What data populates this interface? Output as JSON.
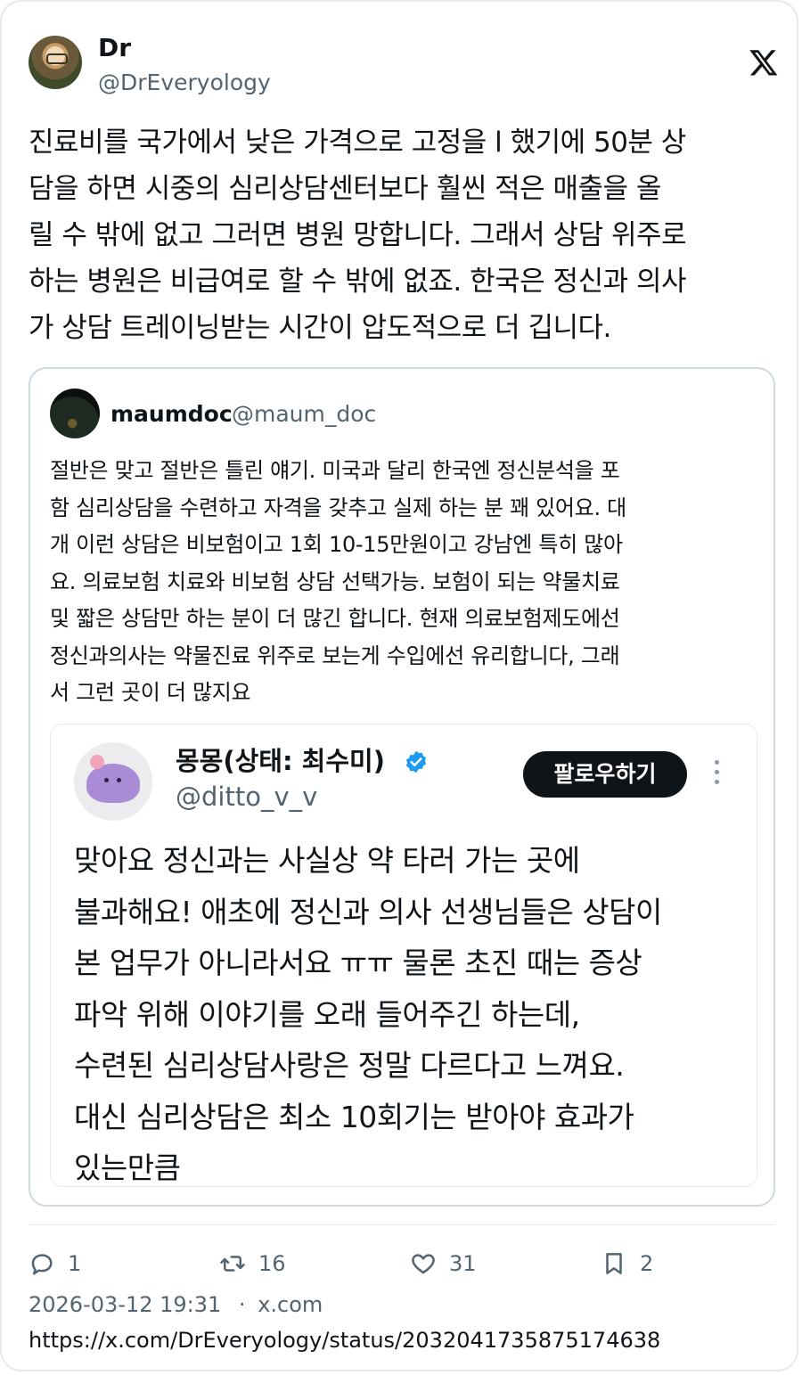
{
  "author": {
    "name": "Dr",
    "handle": "@DrEveryology"
  },
  "tweet": {
    "text": "진료비를 국가에서 낮은 가격으로 고정을 l 했기에 50분 상\n담을 하면 시중의 심리상담센터보다 훨씬 적은 매출을 올\n릴 수 밖에 없고 그러면 병원 망합니다. 그래서 상담 위주로\n하는 병원은 비급여로 할 수 밖에 없죠. 한국은 정신과 의사\n가 상담 트레이닝받는 시간이 압도적으로 더 깁니다."
  },
  "quote": {
    "name": "maumdoc",
    "handle": "@maum_doc",
    "text": "절반은 맞고 절반은 틀린 얘기. 미국과 달리  한국엔 정신분석을 포\n함 심리상담을 수련하고 자격을 갖추고 실제 하는 분 꽤 있어요. 대\n개 이런 상담은 비보험이고 1회 10-15만원이고 강남엔 특히 많아\n요. 의료보험 치료와 비보험 상담 선택가능. 보험이 되는 약물치료\n및 짧은 상담만 하는 분이 더 많긴 합니다. 현재 의료보험제도에선\n정신과의사는 약물진료 위주로 보는게 수입에선 유리합니다, 그래\n서 그런 곳이 더 많지요",
    "embed": {
      "name": "몽몽(상태: 최수미)",
      "handle": "@ditto_v_v",
      "follow_label": "팔로우하기",
      "text": "맞아요 정신과는 사실상 약 타러 가는 곳에\n불과해요! 애초에 정신과 의사 선생님들은 상담이\n본 업무가 아니라서요 ㅠㅠ 물론 초진 때는 증상\n파악 위해 이야기를 오래 들어주긴 하는데,\n수련된 심리상담사랑은 정말 다르다고 느껴요.\n대신 심리상담은 최소 10회기는 받아야 효과가\n있는만큼"
    }
  },
  "actions": {
    "replies": "1",
    "retweets": "16",
    "likes": "31",
    "bookmarks": "2"
  },
  "meta": {
    "timestamp": "2026-03-12 19:31",
    "separator": "·",
    "source": "x.com",
    "url": "https://x.com/DrEveryology/status/2032041735875174638"
  },
  "icons": {
    "platform": "x-logo-icon",
    "verified": "verified-badge-icon",
    "reply": "reply-icon",
    "retweet": "retweet-icon",
    "like": "heart-icon",
    "bookmark": "bookmark-icon",
    "more": "more-options-icon"
  },
  "colors": {
    "text": "#0f1419",
    "secondary": "#536471",
    "verified": "#1d9bf0",
    "border": "#e7e9ea"
  }
}
